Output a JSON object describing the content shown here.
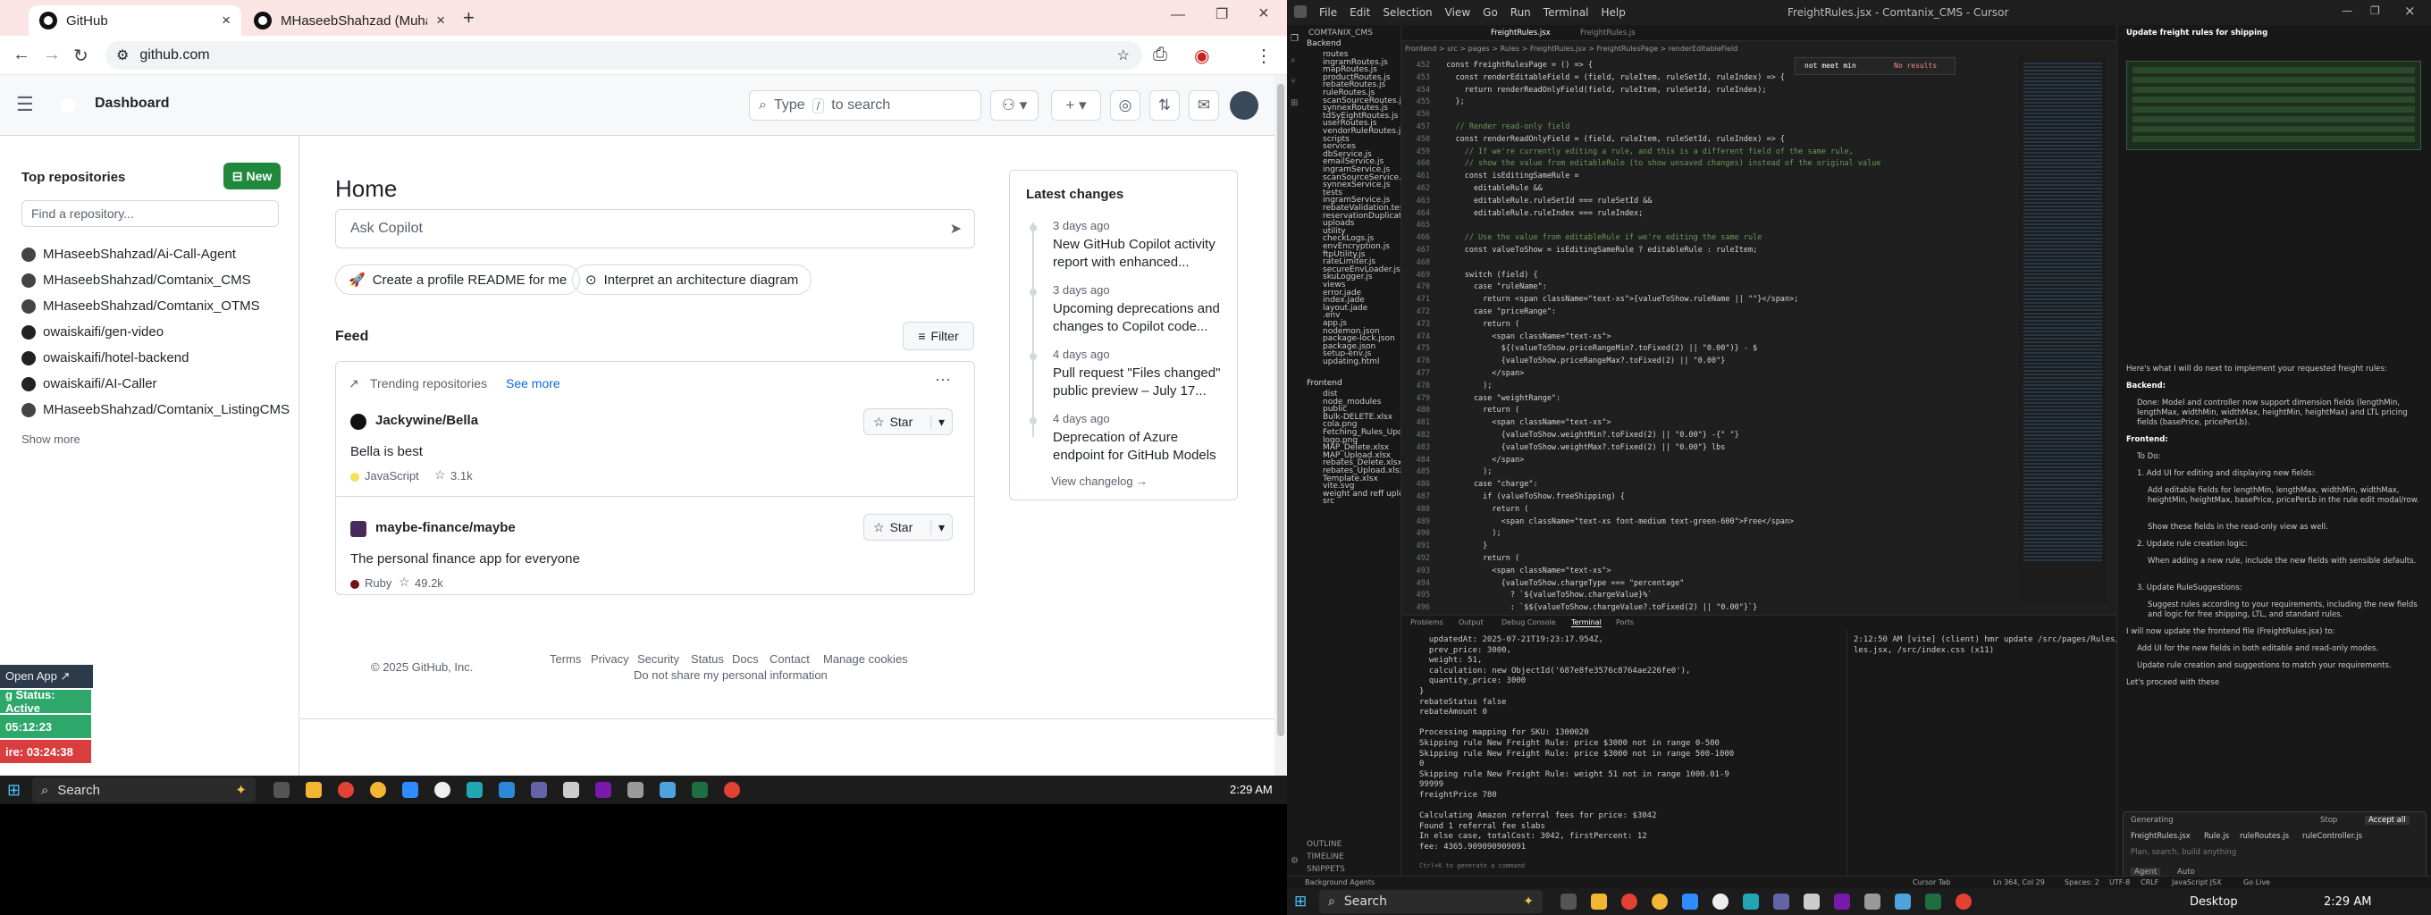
{
  "browser": {
    "tabs": [
      {
        "title": "GitHub",
        "close": "×"
      },
      {
        "title": "MHaseebShahzad (Muhammad",
        "close": "×"
      }
    ],
    "new_tab": "+",
    "url": "github.com"
  },
  "github": {
    "header_title": "Dashboard",
    "search_text": "Type",
    "search_key": "/",
    "search_suffix": "to search",
    "sidebar": {
      "heading": "Top repositories",
      "new_label": "New",
      "find_placeholder": "Find a repository...",
      "repos": [
        "MHaseebShahzad/Ai-Call-Agent",
        "MHaseebShahzad/Comtanix_CMS",
        "MHaseebShahzad/Comtanix_OTMS",
        "owaiskaifi/gen-video",
        "owaiskaifi/hotel-backend",
        "owaiskaifi/AI-Caller",
        "MHaseebShahzad/Comtanix_ListingCMS"
      ],
      "show_more": "Show more"
    },
    "home": {
      "title": "Home",
      "ask_placeholder": "Ask Copilot",
      "chips": [
        "Create a profile README for me",
        "Interpret an architecture diagram"
      ],
      "feed": "Feed",
      "filter": "Filter",
      "trending": "Trending repositories",
      "see_more": "See more",
      "repos": [
        {
          "name": "Jackywine/Bella",
          "desc": "Bella is best",
          "lang": "JavaScript",
          "lang_color": "#f1e05a",
          "stars": "3.1k"
        },
        {
          "name": "maybe-finance/maybe",
          "desc": "The personal finance app for everyone",
          "lang": "Ruby",
          "lang_color": "#701516",
          "stars": "49.2k"
        }
      ],
      "star": "Star"
    },
    "latest": {
      "title": "Latest changes",
      "items": [
        {
          "date": "3 days ago",
          "text": "New GitHub Copilot activity report with enhanced..."
        },
        {
          "date": "3 days ago",
          "text": "Upcoming deprecations and changes to Copilot code..."
        },
        {
          "date": "4 days ago",
          "text": "Pull request \"Files changed\" public preview – July 17..."
        },
        {
          "date": "4 days ago",
          "text": "Deprecation of Azure endpoint for GitHub Models"
        }
      ],
      "view": "View changelog →"
    },
    "footer": {
      "copyright": "© 2025 GitHub, Inc.",
      "links": [
        "Terms",
        "Privacy",
        "Security",
        "Status",
        "Docs",
        "Contact",
        "Manage cookies"
      ],
      "dnsmpi": "Do not share my personal information"
    }
  },
  "overlay": {
    "open_app": "Open App ↗",
    "status": "g Status: Active",
    "t1": "05:12:23",
    "t2": "ire: 03:24:38"
  },
  "taskbar_left": {
    "search": "Search",
    "time": "2:29 AM"
  },
  "cursor": {
    "title": "FreightRules.jsx - Comtanix_CMS - Cursor",
    "menu": [
      "File",
      "Edit",
      "Selection",
      "View",
      "Go",
      "Run",
      "Terminal",
      "Help"
    ],
    "tabs": [
      "FreightRules.jsx",
      "FreightRules.js"
    ],
    "breadcrumb": "Frontend > src > pages > Rules > FreightRules.jsx > FreightRulesPage > renderEditableField",
    "find": "not meet min",
    "find_result": "No results",
    "explorer_title": "COMTANIX_CMS",
    "backend": "Backend",
    "frontend": "Frontend",
    "files_a": [
      "routes",
      "ingramRoutes.js",
      "mapRoutes.js",
      "productRoutes.js",
      "rebateRoutes.js",
      "ruleRoutes.js",
      "scanSourceRoutes.js",
      "synnexRoutes.js",
      "tdSyEightRoutes.js",
      "userRoutes.js",
      "vendorRuleRoutes.js",
      "scripts",
      "services",
      "dbService.js",
      "emailService.js",
      "ingramService.js",
      "scanSourceService.js",
      "synnexService.js",
      "tests",
      "ingramService.js",
      "rebateValidation.test.js",
      "reservationDuplicate.test.js",
      "uploads",
      "utility",
      "checkLogs.js",
      "envEncryption.js",
      "ftpUtility.js",
      "rateLimiter.js",
      "secureEnvLoader.js",
      "skuLogger.js",
      "views",
      "error.jade",
      "index.jade",
      "layout.jade",
      ".env",
      "app.js",
      "nodemon.json",
      "package-lock.json",
      "package.json",
      "setup-env.js",
      "updating.html"
    ],
    "files_b": [
      "dist",
      "node_modules",
      "public",
      "Bulk-DELETE.xlsx",
      "cola.png",
      "Fetching_Rules_Update.xlsx",
      "logo.png",
      "MAP_Delete.xlsx",
      "MAP_Upload.xlsx",
      "rebates_Delete.xlsx",
      "rebates_Upload.xlsx",
      "Template.xlsx",
      "vite.svg",
      "weight and reff upload.xlsx",
      "src"
    ],
    "outline": [
      "OUTLINE",
      "TIMELINE",
      "SNIPPETS"
    ],
    "code": [
      [
        "452",
        "  const FreightRulesPage = () => {"
      ],
      [
        "453",
        "    const renderEditableField = (field, ruleItem, ruleSetId, ruleIndex) => {"
      ],
      [
        "454",
        "      return renderReadOnlyField(field, ruleItem, ruleSetId, ruleIndex);"
      ],
      [
        "455",
        "    };"
      ],
      [
        "456",
        ""
      ],
      [
        "457",
        "    // Render read-only field"
      ],
      [
        "458",
        "    const renderReadOnlyField = (field, ruleItem, ruleSetId, ruleIndex) => {"
      ],
      [
        "459",
        "      // If we're currently editing a rule, and this is a different field of the same rule,"
      ],
      [
        "460",
        "      // show the value from editableRule (to show unsaved changes) instead of the original value"
      ],
      [
        "461",
        "      const isEditingSameRule ="
      ],
      [
        "462",
        "        editableRule &&"
      ],
      [
        "463",
        "        editableRule.ruleSetId === ruleSetId &&"
      ],
      [
        "464",
        "        editableRule.ruleIndex === ruleIndex;"
      ],
      [
        "465",
        ""
      ],
      [
        "466",
        "      // Use the value from editableRule if we're editing the same rule"
      ],
      [
        "467",
        "      const valueToShow = isEditingSameRule ? editableRule : ruleItem;"
      ],
      [
        "468",
        ""
      ],
      [
        "469",
        "      switch (field) {"
      ],
      [
        "470",
        "        case \"ruleName\":"
      ],
      [
        "471",
        "          return <span className=\"text-xs\">{valueToShow.ruleName || \"\"}</span>;"
      ],
      [
        "472",
        "        case \"priceRange\":"
      ],
      [
        "473",
        "          return ("
      ],
      [
        "474",
        "            <span className=\"text-xs\">"
      ],
      [
        "475",
        "              ${(valueToShow.priceRangeMin?.toFixed(2) || \"0.00\")} - $"
      ],
      [
        "476",
        "              {valueToShow.priceRangeMax?.toFixed(2) || \"0.00\"}"
      ],
      [
        "477",
        "            </span>"
      ],
      [
        "478",
        "          );"
      ],
      [
        "479",
        "        case \"weightRange\":"
      ],
      [
        "480",
        "          return ("
      ],
      [
        "481",
        "            <span className=\"text-xs\">"
      ],
      [
        "482",
        "              {valueToShow.weightMin?.toFixed(2) || \"0.00\"} -{\" \"}"
      ],
      [
        "483",
        "              {valueToShow.weightMax?.toFixed(2) || \"0.00\"} lbs"
      ],
      [
        "484",
        "            </span>"
      ],
      [
        "485",
        "          );"
      ],
      [
        "486",
        "        case \"charge\":"
      ],
      [
        "487",
        "          if (valueToShow.freeShipping) {"
      ],
      [
        "488",
        "            return ("
      ],
      [
        "489",
        "              <span className=\"text-xs font-medium text-green-600\">Free</span>"
      ],
      [
        "490",
        "            );"
      ],
      [
        "491",
        "          }"
      ],
      [
        "492",
        "          return ("
      ],
      [
        "493",
        "            <span className=\"text-xs\">"
      ],
      [
        "494",
        "              {valueToShow.chargeType === \"percentage\""
      ],
      [
        "495",
        "                ? `${valueToShow.chargeValue}%`"
      ],
      [
        "496",
        "                : `$${valueToShow.chargeValue?.toFixed(2) || \"0.00\"}`}"
      ]
    ],
    "panel_tabs": [
      "Problems",
      "Output",
      "Debug Console",
      "Terminal",
      "Ports"
    ],
    "terminal": [
      "  updatedAt: 2025-07-21T19:23:17.954Z,",
      "  prev_price: 3000,",
      "  weight: 51,",
      "  calculation: new ObjectId('687e8fe3576c8764ae226fe0'),",
      "  quantity_price: 3000",
      "}",
      "rebateStatus false",
      "rebateAmount 0",
      "",
      "Processing mapping for SKU: 1300020",
      "Skipping rule New Freight Rule: price $3000 not in range 0-500",
      "Skipping rule New Freight Rule: price $3000 not in range 500-1000",
      "0",
      "Skipping rule New Freight Rule: weight 51 not in range 1000.01-9",
      "99999",
      "freightPrice 780",
      "",
      "Calculating Amazon referral fees for price: $3042",
      "Found 1 referral fee slabs",
      "In else case, totalCost: 3042, firstPercent: 12",
      "fee: 4365.909090909091"
    ],
    "terminal2": [
      "2:12:50 AM [vite] (client) hmr update /src/pages/Rules/FreightRu",
      "les.jsx, /src/index.css (x11)"
    ],
    "chat_title": "Update freight rules for shipping",
    "chat": [
      "Here's what I will do next to implement your requested freight rules:",
      "Backend:",
      "Done: Model and controller now support dimension fields (lengthMin, lengthMax, widthMin, widthMax, heightMin, heightMax) and LTL pricing fields (basePrice, pricePerLb).",
      "Frontend:",
      "To Do:",
      "1. Add UI for editing and displaying new fields:",
      "Add editable fields for lengthMin, lengthMax, widthMin, widthMax, heightMin, heightMax, basePrice, pricePerLb in the rule edit modal/row.",
      "Show these fields in the read-only view as well.",
      "2. Update rule creation logic:",
      "When adding a new rule, include the new fields with sensible defaults.",
      "3. Update RuleSuggestions:",
      "Suggest rules according to your requirements, including the new fields and logic for free shipping, LTL, and standard rules.",
      "I will now update the frontend file (FreightRules.jsx) to:",
      "Add UI for the new fields in both editable and read-only modes.",
      "Update rule creation and suggestions to match your requirements.",
      "Let's proceed with these"
    ],
    "generating": "Generating",
    "stop": "Stop",
    "accept": "Accept all",
    "ctx_files": [
      "FreightRules.jsx",
      "Rule.js",
      "ruleRoutes.js",
      "ruleController.js"
    ],
    "input_placeholder": "Plan, search, build anything",
    "agent": "Agent",
    "auto": "Auto",
    "status_left": [
      "Background Agents",
      "Cursor Tab",
      "Ln 364, Col 29",
      "Spaces: 2",
      "UTF-8",
      "CRLF",
      "JavaScript JSX",
      "Go Live"
    ],
    "term_hint": "Ctrl+K to generate a command"
  },
  "taskbar_right": {
    "search": "Search",
    "desktop": "Desktop",
    "time": "2:29 AM"
  }
}
